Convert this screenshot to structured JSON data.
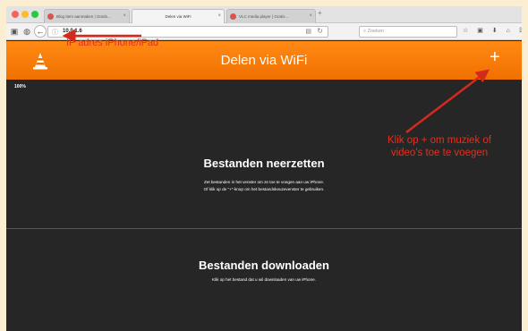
{
  "browser": {
    "tabs": [
      {
        "label": "Blog Item aanmaken | Gratis...",
        "active": false
      },
      {
        "label": "Delen via WiFi",
        "active": true
      },
      {
        "label": "VLC media player | Gratis...",
        "active": false
      }
    ],
    "new_tab_label": "+",
    "address": "10.0.1.6",
    "search_placeholder": "Zoeken",
    "toolbar_icons": "☆ ▣ ⬇ ⌂ ☰"
  },
  "app": {
    "title": "Delen via WiFi",
    "add_label": "+",
    "progress_text": "100%",
    "upload": {
      "heading": "Bestanden neerzetten",
      "line1": "Zet bestanden in het venster om ze toe te voegen aan uw iPhone.",
      "line2": "Of klik op de \"+\"-knop om het bestandskeuzevenster te gebruiken."
    },
    "download": {
      "heading": "Bestanden downloaden",
      "line1": "Klik op het bestand dat u wil downloaden van uw iPhone."
    }
  },
  "annotations": {
    "ip_label": "IP adres iPhone/iPad",
    "add_line1": "Klik op + om muziek of",
    "add_line2": "video's toe te voegen",
    "color": "#e03020"
  },
  "colors": {
    "accent": "#f07a10",
    "background": "#262626",
    "frame": "#fbeed3"
  }
}
